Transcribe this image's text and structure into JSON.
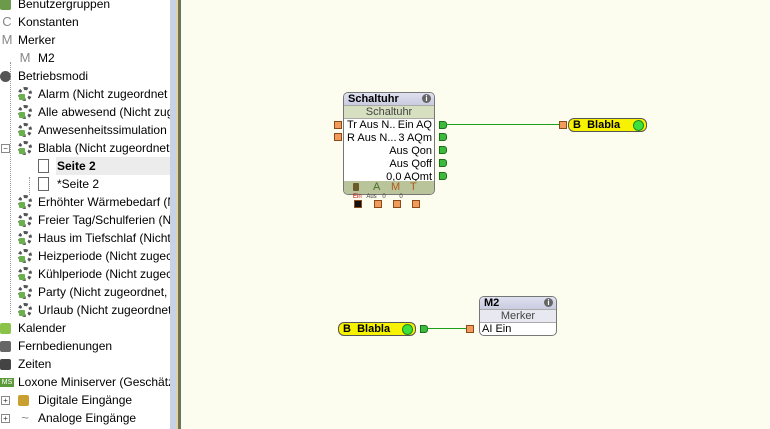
{
  "tree": {
    "items": [
      {
        "label": "Benutzergruppen",
        "icon": "user-group-icon"
      },
      {
        "label": "Konstanten",
        "icon": "constant-icon",
        "glyph": "C"
      },
      {
        "label": "Merker",
        "icon": "marker-icon",
        "glyph": "M"
      },
      {
        "label": "M2",
        "icon": "marker-icon",
        "glyph": "M"
      },
      {
        "label": "Betriebsmodi",
        "icon": "clock-icon"
      },
      {
        "label": "Alarm (Nicht zugeordnet",
        "icon": "mode-gear-icon"
      },
      {
        "label": "Alle abwesend (Nicht zug",
        "icon": "mode-gear-icon"
      },
      {
        "label": "Anwesenheitssimulation",
        "icon": "mode-gear-icon"
      },
      {
        "label": "Blabla (Nicht zugeordnet",
        "icon": "mode-gear-icon"
      },
      {
        "label": "Seite 2",
        "icon": "page-icon"
      },
      {
        "label": "*Seite 2",
        "icon": "page-icon"
      },
      {
        "label": "Erhöhter Wärmebedarf (N",
        "icon": "mode-gear-icon"
      },
      {
        "label": "Freier Tag/Schulferien (N",
        "icon": "mode-gear-icon"
      },
      {
        "label": "Haus im Tiefschlaf (Nicht",
        "icon": "mode-gear-icon"
      },
      {
        "label": "Heizperiode (Nicht zugec",
        "icon": "mode-gear-icon"
      },
      {
        "label": "Kühlperiode (Nicht zugec",
        "icon": "mode-gear-icon"
      },
      {
        "label": "Party (Nicht zugeordnet,",
        "icon": "mode-gear-icon"
      },
      {
        "label": "Urlaub (Nicht zugeordnet",
        "icon": "mode-gear-icon"
      },
      {
        "label": "Kalender",
        "icon": "calendar-icon"
      },
      {
        "label": "Fernbedienungen",
        "icon": "remote-icon"
      },
      {
        "label": "Zeiten",
        "icon": "timer-icon"
      },
      {
        "label": "Loxone Miniserver (Geschätz",
        "icon": "miniserver-icon",
        "glyph": "MS"
      },
      {
        "label": "Digitale Eingänge",
        "icon": "digital-input-icon"
      },
      {
        "label": "Analoge Eingänge",
        "icon": "analog-input-icon",
        "glyph": "~"
      }
    ],
    "expand_minus": "−",
    "expand_plus": "+"
  },
  "schaltuhr": {
    "title": "Schaltuhr",
    "subtitle": "Schaltuhr",
    "info": "i",
    "inputs": [
      "Tr Aus N..",
      "R Aus N..."
    ],
    "outputs": [
      "Ein AQ",
      "3 AQm",
      "Aus Qon",
      "Aus Qoff",
      "0,0 AQmt"
    ],
    "footer": [
      "A",
      "M",
      "T"
    ],
    "param_labels": [
      "Ein",
      "Aus",
      "0",
      "0"
    ]
  },
  "out_var": {
    "type": "B",
    "name": "Blabla"
  },
  "in_var": {
    "type": "B",
    "name": "Blabla"
  },
  "merker": {
    "title": "M2",
    "subtitle": "Merker",
    "info": "i",
    "input": "AI Ein"
  }
}
